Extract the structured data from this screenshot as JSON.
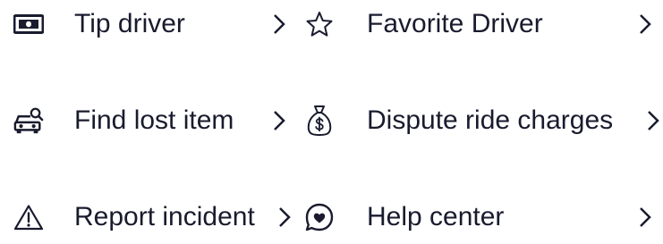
{
  "menu": {
    "items": [
      {
        "label": "Tip driver",
        "icon": "cash-icon",
        "chevron": "chevron-right-icon"
      },
      {
        "label": "Favorite Driver",
        "icon": "star-outline-icon",
        "chevron": "chevron-right-icon"
      },
      {
        "label": "Find lost item",
        "icon": "car-search-icon",
        "chevron": "chevron-right-icon"
      },
      {
        "label": "Dispute ride charges",
        "icon": "money-bag-icon",
        "chevron": "chevron-right-icon"
      },
      {
        "label": "Report incident",
        "icon": "warning-triangle-icon",
        "chevron": "chevron-right-icon"
      },
      {
        "label": "Help center",
        "icon": "heart-chat-icon",
        "chevron": "chevron-right-icon"
      }
    ]
  },
  "colors": {
    "text": "#191b2e",
    "icon": "#191b2e"
  }
}
